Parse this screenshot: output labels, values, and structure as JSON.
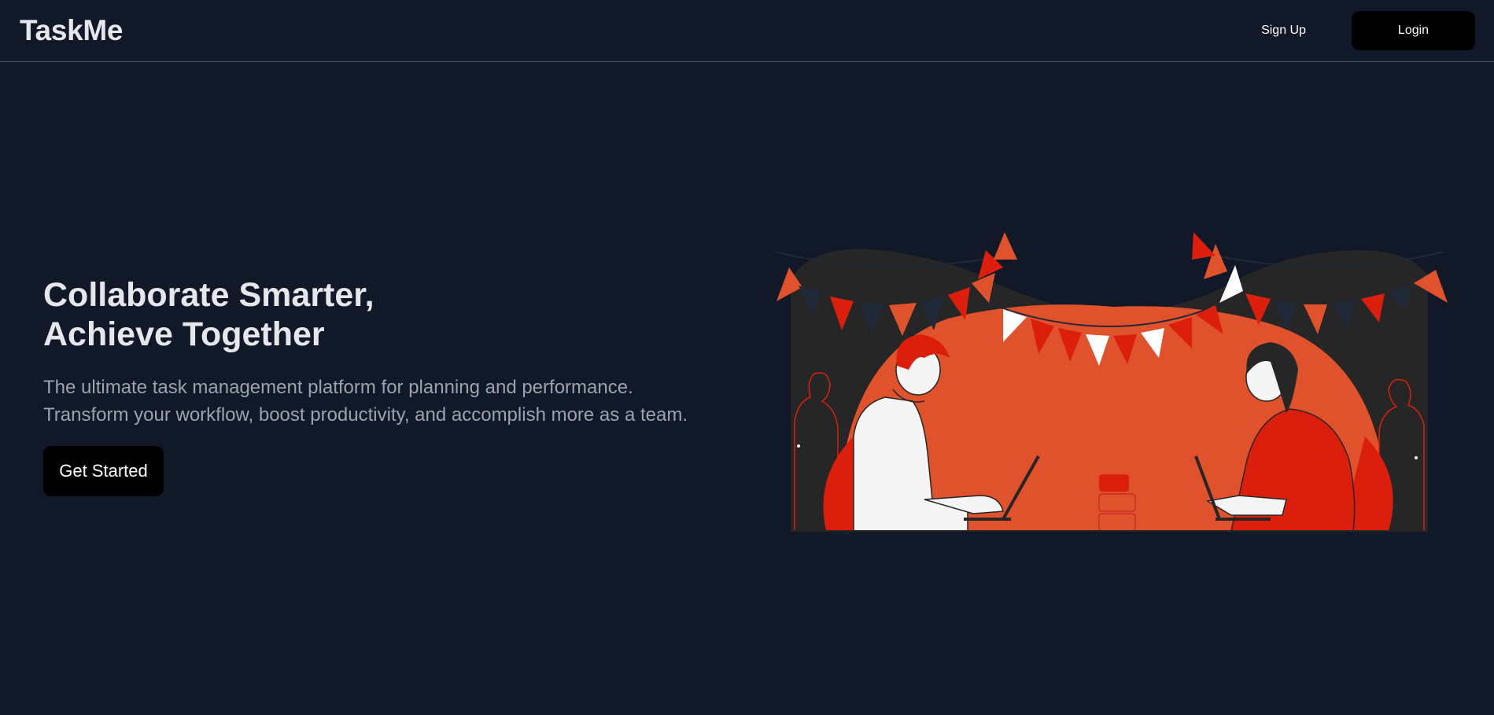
{
  "navbar": {
    "brand": "TaskMe",
    "signup_label": "Sign Up",
    "login_label": "Login"
  },
  "hero": {
    "headline_line1": "Collaborate Smarter,",
    "headline_line2": "Achieve Together",
    "subtext_line1": "The ultimate task management platform for planning and performance.",
    "subtext_line2": "Transform your workflow, boost productivity, and accomplish more as a team.",
    "cta_label": "Get Started"
  },
  "colors": {
    "background": "#111827",
    "accent_red": "#dc1f0c",
    "accent_orange": "#e0522c",
    "dark_tent": "#262626"
  }
}
